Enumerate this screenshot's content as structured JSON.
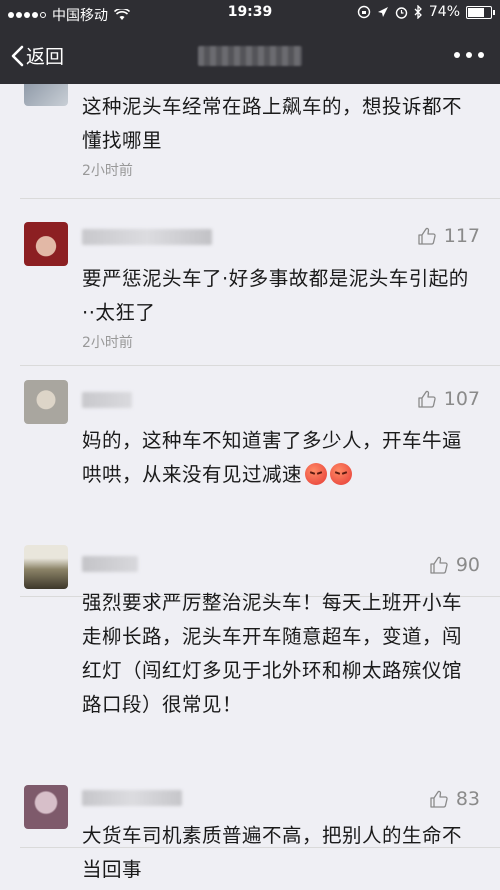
{
  "status_bar": {
    "carrier": "中国移动",
    "time": "19:39",
    "battery": "74%",
    "battery_level": 0.74
  },
  "nav": {
    "back_label": "返回"
  },
  "comments": [
    {
      "text": "这种泥头车经常在路上飙车的，想投诉都不懂找哪里",
      "time": "2小时前",
      "likes": ""
    },
    {
      "text": "要严惩泥头车了·好多事故都是泥头车引起的··太狂了",
      "time": "2小时前",
      "likes": "117"
    },
    {
      "text": "妈的，这种车不知道害了多少人，开车牛逼哄哄，从来没有见过减速",
      "time": "",
      "likes": "107"
    },
    {
      "text": "强烈要求严厉整治泥头车！每天上班开小车走柳长路，泥头车开车随意超车，变道，闯红灯（闯红灯多见于北外环和柳太路殡仪馆路口段）很常见！",
      "time": "",
      "likes": "90"
    },
    {
      "text": "大货车司机素质普遍不高，把别人的生命不当回事",
      "time": "",
      "likes": "83"
    }
  ]
}
